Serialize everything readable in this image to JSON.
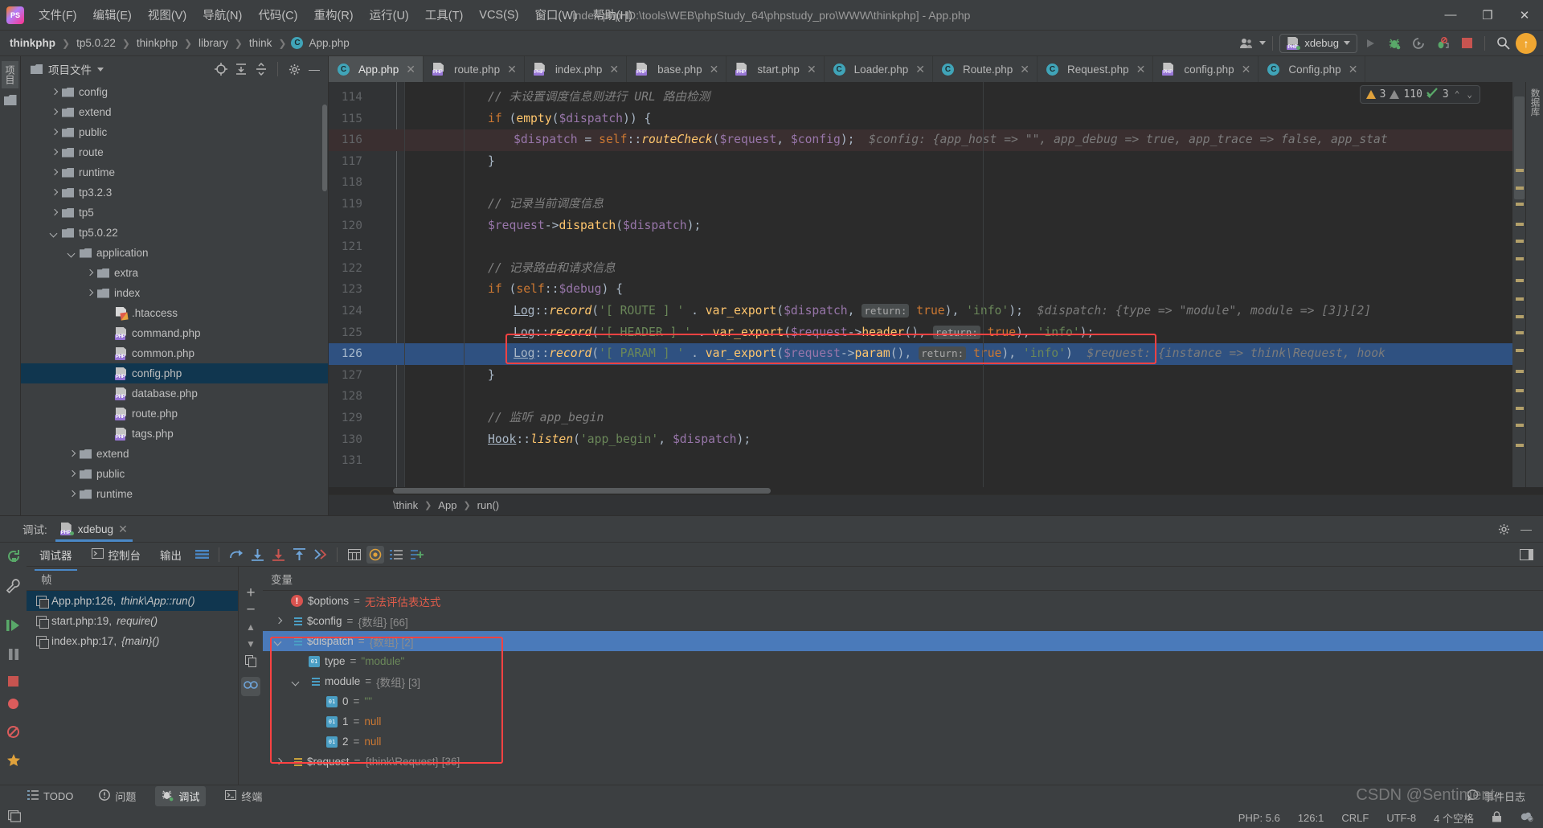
{
  "window": {
    "title": "index.php [D:\\tools\\WEB\\phpStudy_64\\phpstudy_pro\\WWW\\thinkphp] - App.php",
    "minimize": "—",
    "maximize": "❐",
    "close": "✕"
  },
  "menu": [
    {
      "label": "文件(F)"
    },
    {
      "label": "编辑(E)"
    },
    {
      "label": "视图(V)"
    },
    {
      "label": "导航(N)"
    },
    {
      "label": "代码(C)"
    },
    {
      "label": "重构(R)"
    },
    {
      "label": "运行(U)"
    },
    {
      "label": "工具(T)"
    },
    {
      "label": "VCS(S)"
    },
    {
      "label": "窗口(W)"
    },
    {
      "label": "帮助(H)"
    }
  ],
  "breadcrumbs": [
    "thinkphp",
    "tp5.0.22",
    "thinkphp",
    "library",
    "think",
    "App.php"
  ],
  "toolbar": {
    "run_config": "xdebug",
    "php_badge": "PHP",
    "icons": [
      "user-icon",
      "run-icon",
      "debug-icon",
      "rerun-debug-icon",
      "mute-breakpoints-icon",
      "stop-icon",
      "search-icon",
      "update-icon"
    ]
  },
  "project_panel": {
    "title": "项目文件",
    "tree": [
      {
        "label": "config",
        "indent": 1,
        "toggle": "right",
        "icon": "folder"
      },
      {
        "label": "extend",
        "indent": 1,
        "toggle": "right",
        "icon": "folder"
      },
      {
        "label": "public",
        "indent": 1,
        "toggle": "right",
        "icon": "folder"
      },
      {
        "label": "route",
        "indent": 1,
        "toggle": "right",
        "icon": "folder"
      },
      {
        "label": "runtime",
        "indent": 1,
        "toggle": "right",
        "icon": "folder"
      },
      {
        "label": "tp3.2.3",
        "indent": 1,
        "toggle": "right",
        "icon": "folder"
      },
      {
        "label": "tp5",
        "indent": 1,
        "toggle": "right",
        "icon": "folder"
      },
      {
        "label": "tp5.0.22",
        "indent": 1,
        "toggle": "down",
        "icon": "folder"
      },
      {
        "label": "application",
        "indent": 2,
        "toggle": "down",
        "icon": "folder"
      },
      {
        "label": "extra",
        "indent": 3,
        "toggle": "right",
        "icon": "folder"
      },
      {
        "label": "index",
        "indent": 3,
        "toggle": "right",
        "icon": "folder"
      },
      {
        "label": ".htaccess",
        "indent": 4,
        "toggle": "none",
        "icon": "htaccess"
      },
      {
        "label": "command.php",
        "indent": 4,
        "toggle": "none",
        "icon": "php"
      },
      {
        "label": "common.php",
        "indent": 4,
        "toggle": "none",
        "icon": "php"
      },
      {
        "label": "config.php",
        "indent": 4,
        "toggle": "none",
        "icon": "php",
        "selected": true
      },
      {
        "label": "database.php",
        "indent": 4,
        "toggle": "none",
        "icon": "php"
      },
      {
        "label": "route.php",
        "indent": 4,
        "toggle": "none",
        "icon": "php"
      },
      {
        "label": "tags.php",
        "indent": 4,
        "toggle": "none",
        "icon": "php"
      },
      {
        "label": "extend",
        "indent": 2,
        "toggle": "right",
        "icon": "folder"
      },
      {
        "label": "public",
        "indent": 2,
        "toggle": "right",
        "icon": "folder"
      },
      {
        "label": "runtime",
        "indent": 2,
        "toggle": "right",
        "icon": "folder"
      }
    ]
  },
  "editor_tabs": [
    {
      "label": "App.php",
      "icon": "class",
      "active": true
    },
    {
      "label": "route.php",
      "icon": "php"
    },
    {
      "label": "index.php",
      "icon": "php"
    },
    {
      "label": "base.php",
      "icon": "php"
    },
    {
      "label": "start.php",
      "icon": "php"
    },
    {
      "label": "Loader.php",
      "icon": "class"
    },
    {
      "label": "Route.php",
      "icon": "class"
    },
    {
      "label": "Request.php",
      "icon": "class"
    },
    {
      "label": "config.php",
      "icon": "php"
    },
    {
      "label": "Config.php",
      "icon": "class"
    }
  ],
  "inspection": {
    "warnings": "3",
    "weak_warnings": "110",
    "checks": "3",
    "prev": "⌃",
    "next": "⌄"
  },
  "code": {
    "first_line": 114,
    "lines": [
      {
        "n": 114,
        "fold": "none"
      },
      {
        "n": 115,
        "fold": "open"
      },
      {
        "n": 116,
        "fold": "none",
        "breakpoint": true,
        "highlight": true
      },
      {
        "n": 117,
        "fold": "close"
      },
      {
        "n": 118,
        "fold": "none"
      },
      {
        "n": 119,
        "fold": "none"
      },
      {
        "n": 120,
        "fold": "none"
      },
      {
        "n": 121,
        "fold": "none"
      },
      {
        "n": 122,
        "fold": "none"
      },
      {
        "n": 123,
        "fold": "open"
      },
      {
        "n": 124,
        "fold": "none"
      },
      {
        "n": 125,
        "fold": "none"
      },
      {
        "n": 126,
        "fold": "none",
        "current": true
      },
      {
        "n": 127,
        "fold": "close"
      },
      {
        "n": 128,
        "fold": "none"
      },
      {
        "n": 129,
        "fold": "none"
      },
      {
        "n": 130,
        "fold": "none"
      },
      {
        "n": 131,
        "fold": "none"
      }
    ],
    "text": {
      "l114": "// 未设置调度信息则进行 URL 路由检测",
      "l115": "if (empty($dispatch)) {",
      "l116": "$dispatch = self::routeCheck($request, $config);",
      "l116_hint": "$config: {app_host => \"\", app_debug => true, app_trace => false, app_stat",
      "l117": "}",
      "l119": "// 记录当前调度信息",
      "l120": "$request->dispatch($dispatch);",
      "l122": "// 记录路由和请求信息",
      "l123": "if (self::$debug) {",
      "l124": "Log::record('[ ROUTE ] ' . var_export($dispatch, return: true), 'info');",
      "l124_hint": "$dispatch: {type => \"module\", module => [3]}[2]",
      "l125": "Log::record('[ HEADER ] ' . var_export($request->header(), return: true), 'info');",
      "l126": "Log::record('[ PARAM ] ' . var_export($request->param(), return: true), 'info');",
      "l126_hint": "$request: {instance => think\\Request, hook",
      "l127": "}",
      "l129": "// 监听 app_begin",
      "l130": "Hook::listen('app_begin', $dispatch);"
    },
    "breadcrumb": [
      "\\think",
      "App",
      "run()"
    ]
  },
  "debug": {
    "panel_label": "调试:",
    "session_tab": "xdebug",
    "sub_tabs": [
      {
        "label": "调试器",
        "active": true
      },
      {
        "label": "控制台",
        "icon": "console-icon"
      },
      {
        "label": "输出"
      }
    ],
    "frames_header": "帧",
    "frames": [
      {
        "file": "App.php:126,",
        "fn": "think\\App::run()",
        "selected": true
      },
      {
        "file": "start.php:19,",
        "fn": "require()"
      },
      {
        "file": "index.php:17,",
        "fn": "{main}()"
      }
    ],
    "vars_header": "变量",
    "variables": [
      {
        "indent": 0,
        "toggle": "none",
        "icon": "error",
        "name": "$options",
        "eq": "=",
        "value": "无法评估表达式",
        "value_class": "v-red"
      },
      {
        "indent": 0,
        "toggle": "right",
        "icon": "array",
        "name": "$config",
        "eq": "=",
        "value": "{数组} [66]",
        "value_class": "v-type"
      },
      {
        "indent": 0,
        "toggle": "down",
        "icon": "array",
        "name": "$dispatch",
        "eq": "=",
        "value": "{数组} [2]",
        "value_class": "v-type",
        "selected": true
      },
      {
        "indent": 1,
        "toggle": "none",
        "icon": "prim",
        "name": "type",
        "eq": "=",
        "value": "\"module\"",
        "value_class": "v-str"
      },
      {
        "indent": 1,
        "toggle": "down",
        "icon": "array",
        "name": "module",
        "eq": "=",
        "value": "{数组} [3]",
        "value_class": "v-type"
      },
      {
        "indent": 2,
        "toggle": "none",
        "icon": "prim",
        "name": "0",
        "eq": "=",
        "value": "\"\"",
        "value_class": "v-str"
      },
      {
        "indent": 2,
        "toggle": "none",
        "icon": "prim",
        "name": "1",
        "eq": "=",
        "value": "null",
        "value_class": "v-null"
      },
      {
        "indent": 2,
        "toggle": "none",
        "icon": "prim",
        "name": "2",
        "eq": "=",
        "value": "null",
        "value_class": "v-null"
      },
      {
        "indent": 0,
        "toggle": "right",
        "icon": "obj",
        "name": "$request",
        "eq": "=",
        "value": "{think\\Request} [36]",
        "value_class": "v-type"
      }
    ]
  },
  "bottom_bar": [
    {
      "label": "TODO",
      "icon": "todo-icon"
    },
    {
      "label": "问题",
      "icon": "problems-icon"
    },
    {
      "label": "调试",
      "icon": "debug-icon",
      "active": true
    },
    {
      "label": "终端",
      "icon": "terminal-icon"
    }
  ],
  "status_bar": {
    "event_log": "事件日志",
    "php_version": "PHP: 5.6",
    "caret": "126:1",
    "line_sep": "CRLF",
    "encoding": "UTF-8",
    "indent": "4 个空格"
  },
  "watermark": "CSDN @Sentiment",
  "colors": {
    "accent": "#4a88c7",
    "selection": "#2f5181",
    "red_box": "#ff4242",
    "warning": "#e0a23c",
    "string": "#6a8759",
    "keyword": "#cc7832"
  }
}
